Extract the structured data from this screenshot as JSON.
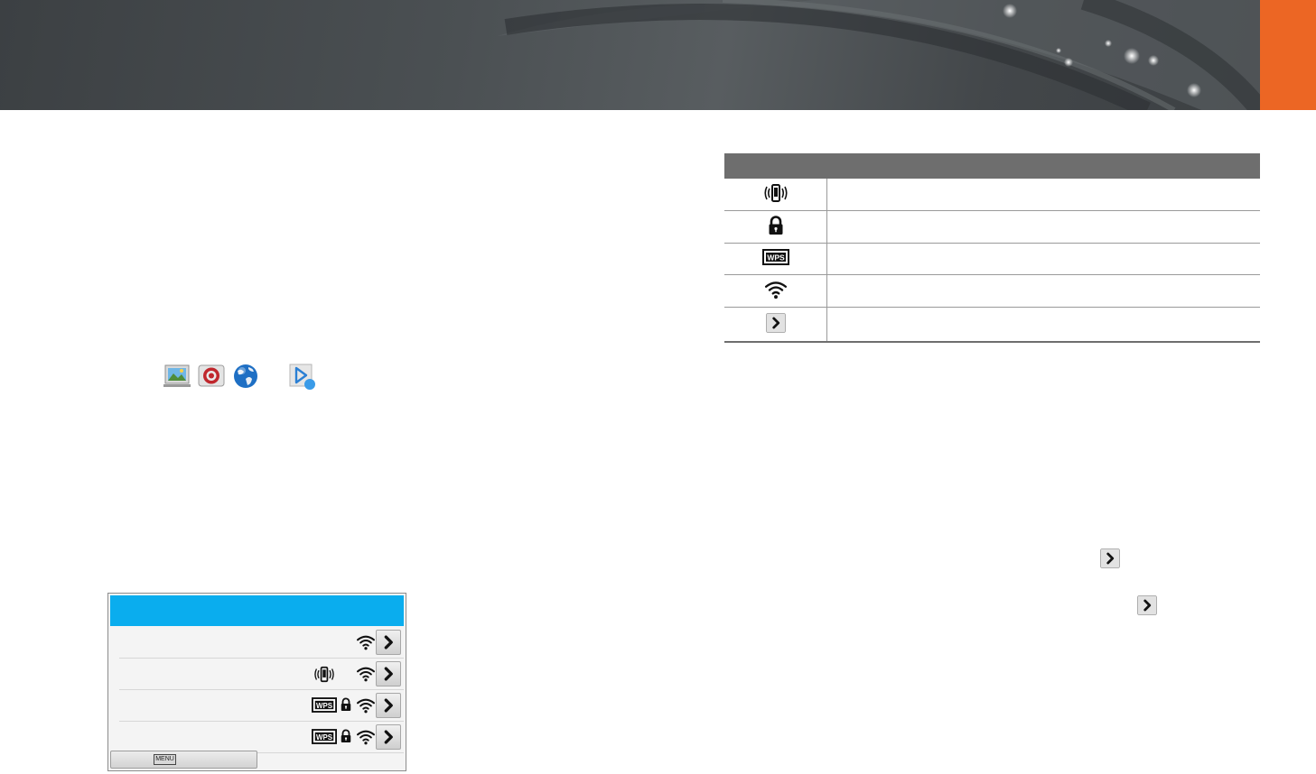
{
  "header": {
    "title": "",
    "accent_color": "#ec6624",
    "banner_color": "#43474a"
  },
  "left_column": {
    "mode_icons": [
      "photo-frame-icon",
      "target-icon",
      "globe-icon",
      "play-share-icon"
    ]
  },
  "camera_screen": {
    "title": "",
    "title_bar_color": "#0aadee",
    "rows": [
      {
        "name": "",
        "icons": [
          "wifi-icon"
        ]
      },
      {
        "name": "",
        "icons": [
          "vibrate-phone-icon",
          "wifi-icon"
        ]
      },
      {
        "name": "",
        "icons": [
          "wps-icon",
          "lock-icon",
          "wifi-icon"
        ]
      },
      {
        "name": "",
        "icons": [
          "wps-icon",
          "lock-icon",
          "wifi-icon"
        ]
      }
    ],
    "footer": {
      "key": "MENU",
      "label": ""
    }
  },
  "icon_table": {
    "header": {
      "icon": "",
      "description": ""
    },
    "rows": [
      {
        "icon": "vibrate-phone-icon",
        "description": ""
      },
      {
        "icon": "lock-icon",
        "description": ""
      },
      {
        "icon": "wps-icon",
        "description": ""
      },
      {
        "icon": "wifi-icon",
        "description": ""
      },
      {
        "icon": "chevron-right-icon",
        "description": ""
      }
    ]
  }
}
